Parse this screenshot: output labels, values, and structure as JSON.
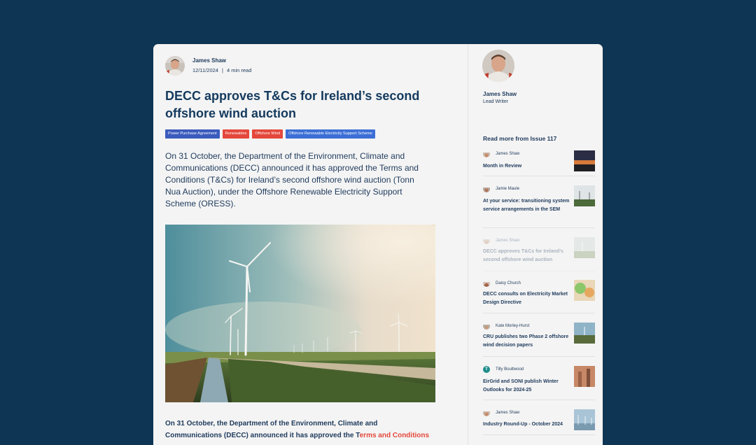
{
  "article": {
    "author": "James Shaw",
    "date": "12/11/2024",
    "separator": "|",
    "read_time": "4 min read",
    "title": "DECC approves T&Cs for Ireland’s second offshore wind auction",
    "tags": [
      "Power Purchase Agreement",
      "Renewables",
      "Offshore Wind",
      "Offshore Renewable Electricity Support Scheme"
    ],
    "lead": "On 31 October, the Department of the Environment, Climate and Communications (DECC) announced it has approved the Terms and Conditions (T&Cs) for Ireland’s second offshore wind auction (Tonn Nua Auction), under the Offshore Renewable Electricity Support Scheme (ORESS).",
    "body_start": "On 31 October, the Department of the Environment, Climate and Communications (DECC) announced it has approved the T",
    "body_link": "erms and Conditions"
  },
  "sidebar": {
    "author_name": "James Shaw",
    "author_role": "Lead Writer",
    "read_more": "Read more from Issue 117",
    "items": [
      {
        "author": "James Shaw",
        "title": "Month in Review"
      },
      {
        "author": "Jamie Maule",
        "title": "At your service: transitioning system service arrangements in the SEM"
      },
      {
        "author": "James Shaw",
        "title": "DECC approves T&Cs for Ireland’s second offshore wind auction"
      },
      {
        "author": "Daisy Church",
        "title": "DECC consults on Electricity Market Design Directive"
      },
      {
        "author": "Kate Morley-Hurst",
        "title": "CRU publishes two Phase 2 offshore wind decision papers"
      },
      {
        "author": "Tilly Boultwood",
        "title": "EirGrid and SONI publish Winter Outlooks for 2024-25",
        "initial": "T"
      },
      {
        "author": "James Shaw",
        "title": "Industry Round-Up - October 2024"
      }
    ]
  },
  "colors": {
    "page_bg": "#0e3553",
    "card_bg": "#f4f4f4",
    "text": "#1e3a5c",
    "tag_blue": "#3b5bbd",
    "tag_red": "#e4483c",
    "link": "#e4483c"
  },
  "icons": {
    "author_avatar": "person-portrait",
    "teal_avatar": "initial-avatar"
  }
}
